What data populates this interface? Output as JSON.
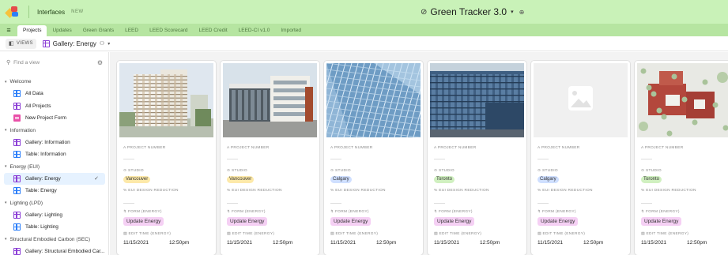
{
  "top": {
    "base_name": "Interfaces",
    "new_badge": "NEW",
    "title": "Green Tracker 3.0",
    "title_caret": "▾"
  },
  "tabs": [
    {
      "label": "Projects",
      "active": true
    },
    {
      "label": "Updates",
      "active": false
    },
    {
      "label": "Green Grants",
      "active": false
    },
    {
      "label": "LEED",
      "active": false
    },
    {
      "label": "LEED Scorecard",
      "active": false
    },
    {
      "label": "LEED Credit",
      "active": false
    },
    {
      "label": "LEED-CI v1.0",
      "active": false
    },
    {
      "label": "Imported",
      "active": false
    }
  ],
  "viewbar": {
    "views_label": "VIEWS",
    "current_view": "Gallery: Energy"
  },
  "sidebar": {
    "search_placeholder": "Find a view",
    "groups": [
      {
        "label": "Welcome",
        "items": [
          {
            "label": "All Data",
            "icon": "grid-blue"
          },
          {
            "label": "All Projects",
            "icon": "grid-purple"
          },
          {
            "label": "New Project Form",
            "icon": "form-pink"
          }
        ]
      },
      {
        "label": "Information",
        "items": [
          {
            "label": "Gallery: Information",
            "icon": "grid-purple"
          },
          {
            "label": "Table: Information",
            "icon": "grid-blue"
          }
        ]
      },
      {
        "label": "Energy (EUI)",
        "items": [
          {
            "label": "Gallery: Energy",
            "icon": "grid-purple",
            "active": true
          },
          {
            "label": "Table: Energy",
            "icon": "grid-blue"
          }
        ]
      },
      {
        "label": "Lighting (LPD)",
        "items": [
          {
            "label": "Gallery: Lighting",
            "icon": "grid-purple"
          },
          {
            "label": "Table: Lighting",
            "icon": "grid-blue"
          }
        ]
      },
      {
        "label": "Structural Embodied Carbon (SEC)",
        "items": [
          {
            "label": "Gallery: Structural Embodied Car...",
            "icon": "grid-purple"
          }
        ]
      }
    ]
  },
  "field_labels": {
    "project_number": "PROJECT NUMBER",
    "studio": "STUDIO",
    "eui_reduction": "EUI DESIGN REDUCTION",
    "form": "FORM (ENERGY)",
    "edit_time": "EDIT TIME (ENERGY)"
  },
  "cards": [
    {
      "studio": "Vancouver",
      "studio_color": "#fde9a9",
      "update": "Update Energy",
      "date": "11/15/2021",
      "time": "12:50pm",
      "image": "tower-white"
    },
    {
      "studio": "Vancouver",
      "studio_color": "#fde9a9",
      "update": "Update Energy",
      "date": "11/15/2021",
      "time": "12:50pm",
      "image": "modern-glass"
    },
    {
      "studio": "Calgary",
      "studio_color": "#cfdfff",
      "update": "Update Energy",
      "date": "11/15/2021",
      "time": "12:50pm",
      "image": "glass-facade"
    },
    {
      "studio": "Toronto",
      "studio_color": "#d0f0c0",
      "update": "Update Energy",
      "date": "11/15/2021",
      "time": "12:50pm",
      "image": "blue-glass-block"
    },
    {
      "studio": "Calgary",
      "studio_color": "#cfdfff",
      "update": "Update Energy",
      "date": "11/15/2021",
      "time": "12:50pm",
      "image": "placeholder"
    },
    {
      "studio": "Toronto",
      "studio_color": "#d0f0c0",
      "update": "Update Energy",
      "date": "11/15/2021",
      "time": "12:50pm",
      "image": "aerial-plan"
    }
  ],
  "colors": {
    "topbar": "#c9f2b8",
    "tabbar": "#b6e5a1",
    "update_pill": "#f5d0f4",
    "active_view_bg": "#e6f2ff"
  }
}
